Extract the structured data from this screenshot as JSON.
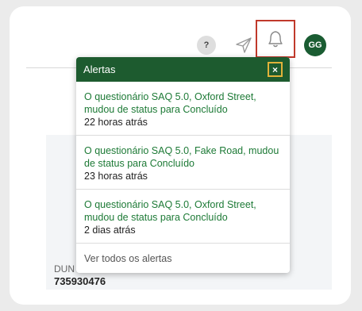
{
  "header": {
    "help_label": "?",
    "avatar_initials": "GG"
  },
  "alerts_panel": {
    "title": "Alertas",
    "close_label": "×",
    "items": [
      {
        "message": "O questionário SAQ 5.0, Oxford Street, mudou de status para Concluído",
        "time": "22 horas atrás"
      },
      {
        "message": "O questionário SAQ 5.0, Fake Road, mudou de status para Concluído",
        "time": "23 horas atrás"
      },
      {
        "message": "O questionário SAQ 5.0, Oxford Street, mudou de status para Concluído",
        "time": "2 dias atrás"
      }
    ],
    "view_all_label": "Ver todos os alertas"
  },
  "background": {
    "label": "DUN",
    "value": "735930476"
  },
  "colors": {
    "brand_green": "#1d5b2f",
    "link_green": "#1d7a36",
    "focus_red": "#c0392b",
    "focus_gold": "#e1b23a"
  }
}
